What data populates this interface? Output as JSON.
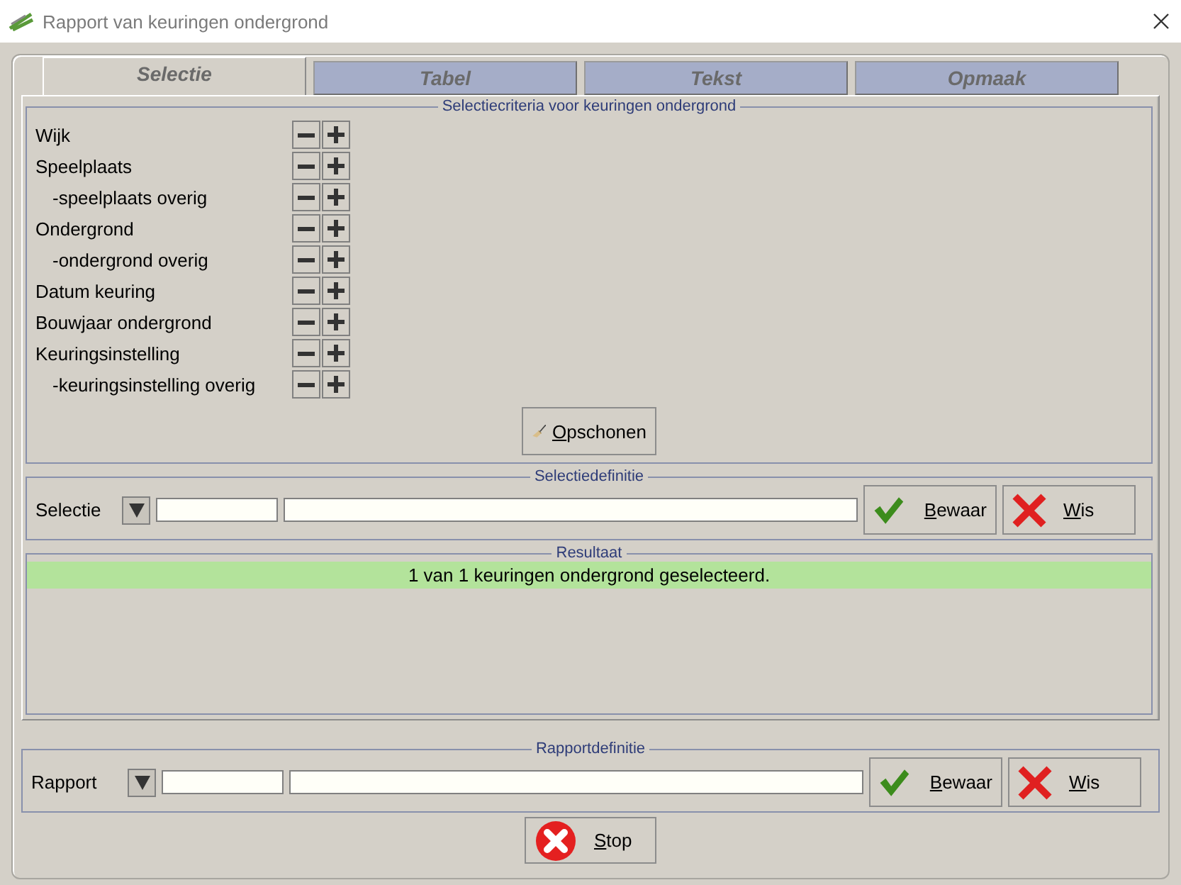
{
  "window": {
    "title": "Rapport van keuringen ondergrond"
  },
  "tabs": [
    {
      "label": "Selectie",
      "selected": true
    },
    {
      "label": "Tabel",
      "selected": false
    },
    {
      "label": "Tekst",
      "selected": false
    },
    {
      "label": "Opmaak",
      "selected": false
    }
  ],
  "criteria": {
    "title": "Selectiecriteria voor keuringen ondergrond",
    "rows": [
      {
        "label": "Wijk"
      },
      {
        "label": "Speelplaats",
        "children": [
          {
            "label": "-speelplaats overig"
          }
        ]
      },
      {
        "label": "Ondergrond",
        "children": [
          {
            "label": "-ondergrond overig"
          }
        ]
      },
      {
        "label": "Datum keuring"
      },
      {
        "label": "Bouwjaar ondergrond"
      },
      {
        "label": "Keuringsinstelling",
        "children": [
          {
            "label": "-keuringsinstelling overig"
          }
        ]
      }
    ],
    "cleanup_button": {
      "label": "Opschonen"
    }
  },
  "selection_definition": {
    "title": "Selectiedefinitie",
    "label": "Selectie",
    "buttons": [
      {
        "kind": "save",
        "label": "Bewaar"
      },
      {
        "kind": "clear",
        "label": "Wis"
      }
    ]
  },
  "result": {
    "title": "Resultaat",
    "message": "1 van 1 keuringen ondergrond geselecteerd."
  },
  "report_definition": {
    "title": "Rapportdefinitie",
    "label": "Rapport",
    "buttons": [
      {
        "kind": "save",
        "label": "Bewaar"
      },
      {
        "kind": "clear",
        "label": "Wis"
      }
    ]
  },
  "stop_button": {
    "label": "Stop"
  }
}
